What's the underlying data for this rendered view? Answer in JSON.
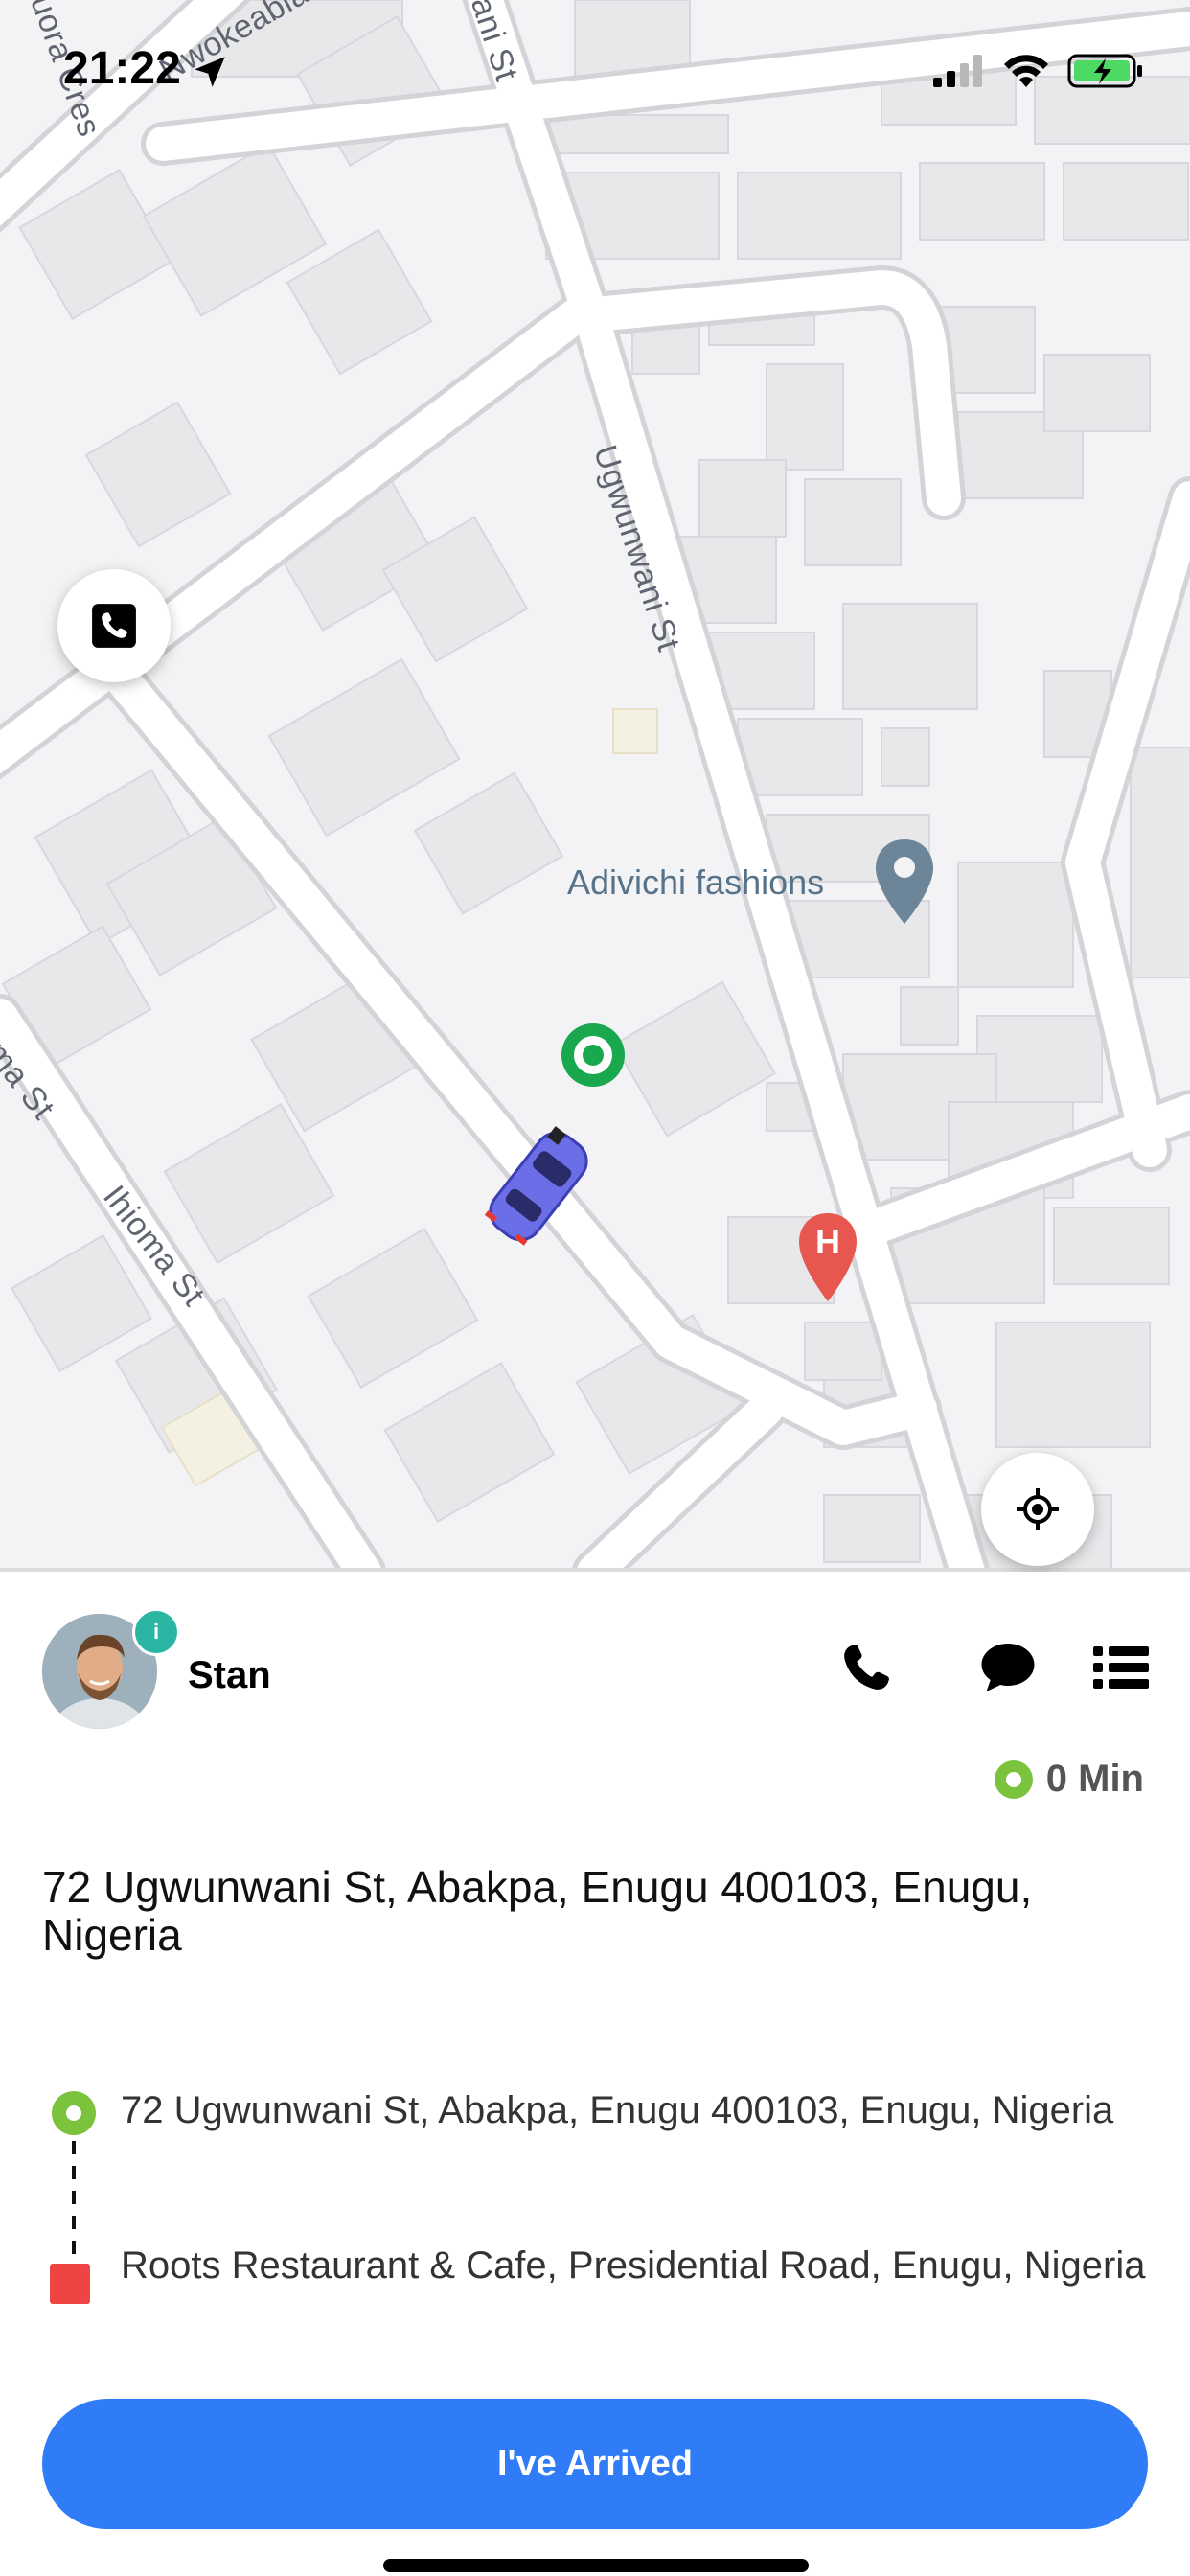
{
  "status_bar": {
    "time": "21:22"
  },
  "map": {
    "road_labels": {
      "nwokeabia": "Nwokeabia Cro",
      "uduora": "uora Cres",
      "ani_st": "ani St",
      "ugwunwani": "Ugwunwani St",
      "ihioma": "Ihioma St",
      "ma_st": "ma St"
    },
    "poi": {
      "fashion_label": "Adivichi fashions"
    }
  },
  "driver": {
    "name": "Stan",
    "info_badge": "i"
  },
  "eta": {
    "text": "0 Min"
  },
  "pickup": {
    "address": "72 Ugwunwani St, Abakpa, Enugu 400103, Enugu, Nigeria"
  },
  "route": {
    "from": "72 Ugwunwani St, Abakpa, Enugu 400103, Enugu, Nigeria",
    "to": "Roots Restaurant & Cafe, Presidential Road, Enugu, Nigeria"
  },
  "actions": {
    "arrived_label": "I've Arrived"
  },
  "colors": {
    "accent": "#2f7cf6",
    "pickup_green": "#7cc33d",
    "dropoff_red": "#ef4444"
  }
}
